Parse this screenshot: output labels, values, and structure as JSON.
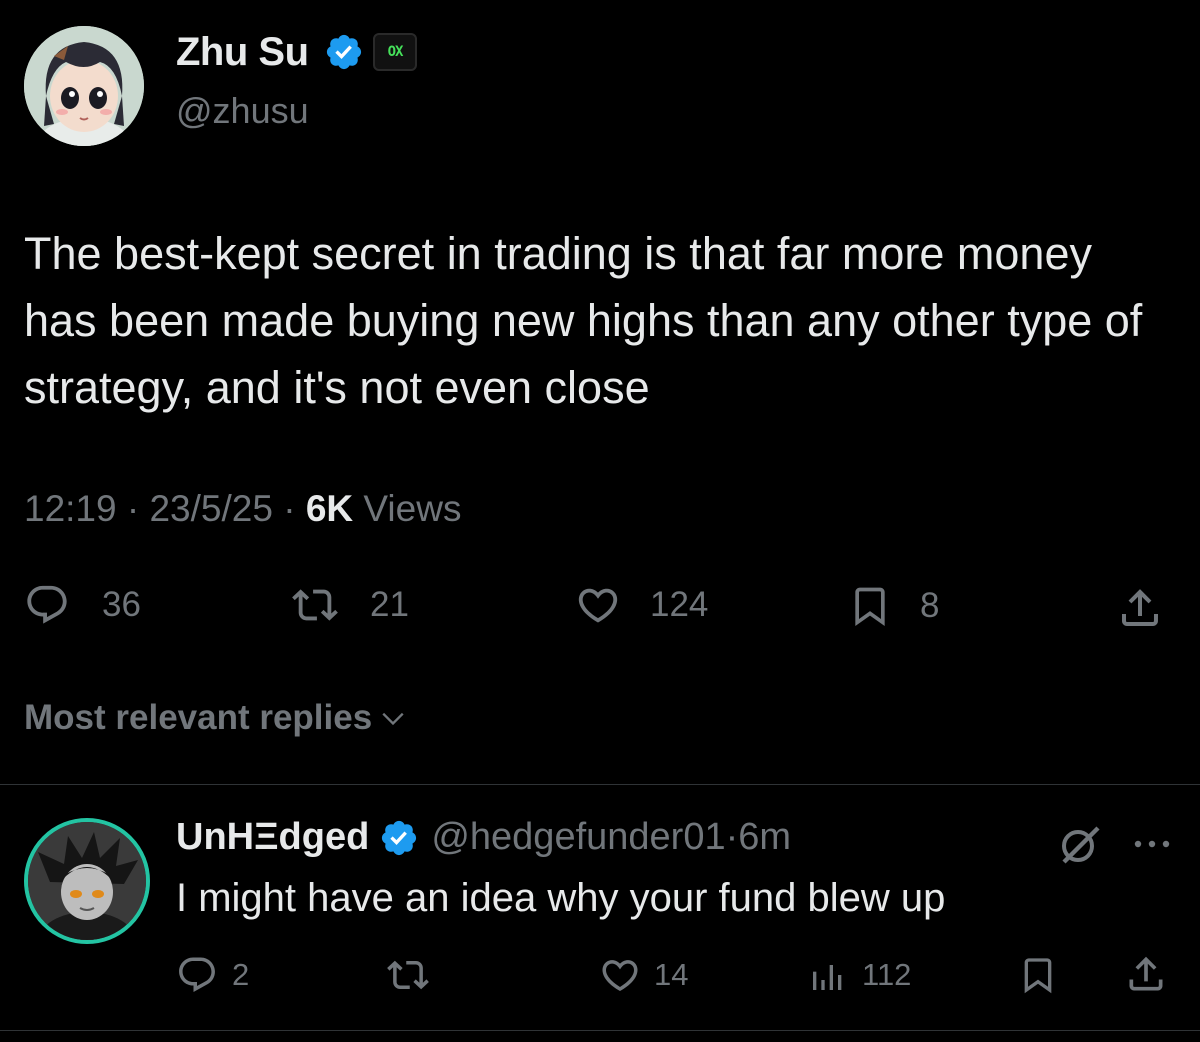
{
  "tweet": {
    "author_name": "Zhu Su",
    "author_handle": "@zhusu",
    "affiliate_badge_text": "OX",
    "text": "The best-kept secret in trading is that far more money has been made buying new highs than any other type of strategy, and it's not even close",
    "time": "12:19",
    "separator1": " · ",
    "date": "23/5/25",
    "separator2": " · ",
    "views_count": "6K",
    "views_label": " Views",
    "stats": {
      "replies": "36",
      "reposts": "21",
      "likes": "124",
      "bookmarks": "8"
    }
  },
  "replies_section": {
    "sort_label": "Most relevant replies"
  },
  "reply": {
    "author_name": "UnHΞdged",
    "author_handle": "@hedgefunder01",
    "separator": " · ",
    "time": "6m",
    "text": "I might have an idea why your fund blew up",
    "stats": {
      "replies": "2",
      "likes": "14",
      "views": "112"
    }
  },
  "colors": {
    "background": "#000000",
    "primary_text": "#e7e9ea",
    "secondary_text": "#71767b",
    "verified_blue": "#1d9bf0",
    "divider": "#2f3336",
    "avatar_ring": "#23c4a3",
    "affiliate_green": "#45e05a"
  },
  "icons": [
    "verified-badge-icon",
    "reply-icon",
    "repost-icon",
    "like-icon",
    "bookmark-icon",
    "share-icon",
    "chevron-down-icon",
    "views-icon",
    "grok-icon",
    "more-icon"
  ]
}
